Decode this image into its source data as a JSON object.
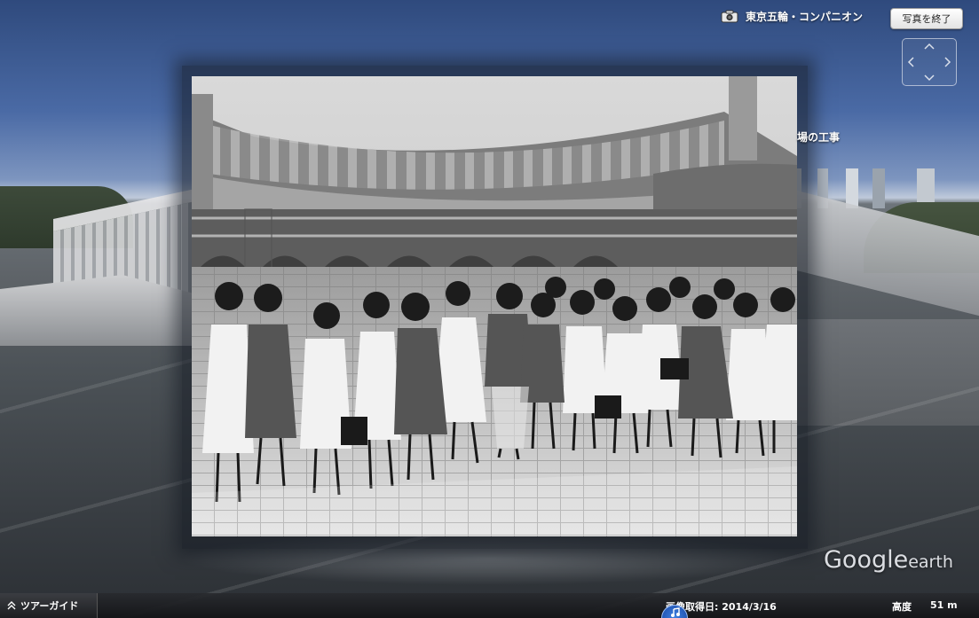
{
  "app": {
    "tour_title": "東京五輪・コンパニオン",
    "exit_photo_label": "写真を終了",
    "side_caption": "場の工事"
  },
  "watermark": {
    "google": "Google",
    "earth": "earth"
  },
  "status_bar": {
    "tour_guide_label": "ツアーガイド",
    "imagery_date": "画像取得日: 2014/3/16",
    "altitude_label": "高度",
    "altitude_value": "51 m"
  },
  "icons": {
    "camera": "camera-icon",
    "nav": "navigation-arrows",
    "tour": "chevron-up-icon",
    "music": "music-note-icon"
  },
  "colors": {
    "accent_blue": "#3e7fe0",
    "status_bar": "#1d1e21"
  }
}
